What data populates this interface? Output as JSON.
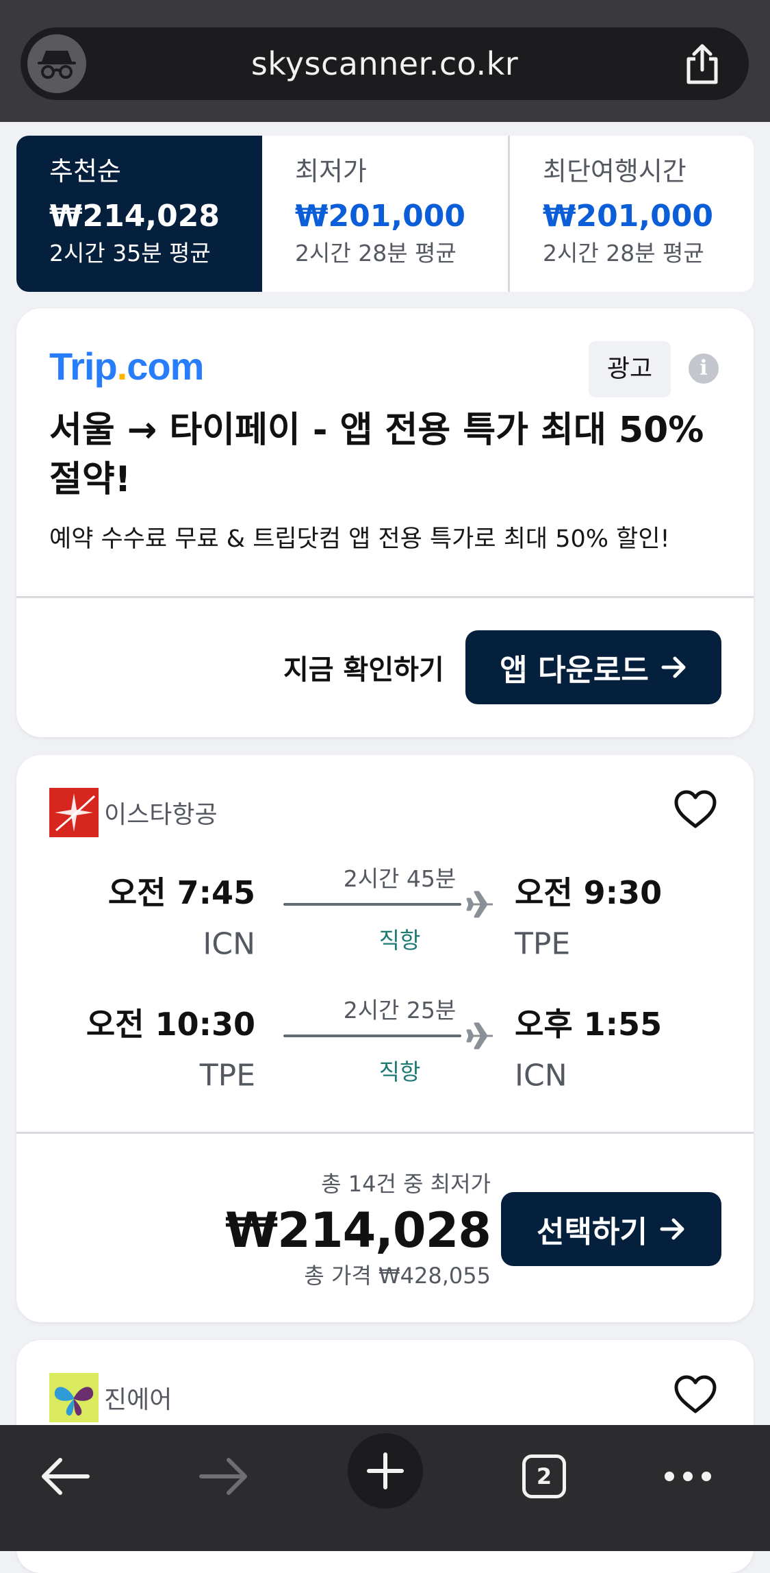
{
  "browser": {
    "url": "skyscanner.co.kr",
    "tab_count": "2"
  },
  "sort_tabs": [
    {
      "label": "추천순",
      "price": "₩214,028",
      "duration": "2시간 35분 평균",
      "selected": true
    },
    {
      "label": "최저가",
      "price": "₩201,000",
      "duration": "2시간 28분 평균",
      "selected": false
    },
    {
      "label": "최단여행시간",
      "price": "₩201,000",
      "duration": "2시간 28분 평균",
      "selected": false
    }
  ],
  "ad": {
    "logo_main": "Trip",
    "logo_dot": ".",
    "logo_tail": "com",
    "badge": "광고",
    "title": "서울 → 타이페이 - 앱 전용 특가 최대 50% 절약!",
    "description": "예약 수수료 무료 & 트립닷컴 앱 전용 특가로 최대 50% 할인!",
    "check_link": "지금 확인하기",
    "download_button": "앱 다운로드"
  },
  "flight_results": [
    {
      "airline": "이스타항공",
      "legs": [
        {
          "depart_time": "오전 7:45",
          "depart_code": "ICN",
          "duration": "2시간 45분",
          "stops": "직항",
          "arrive_time": "오전 9:30",
          "arrive_code": "TPE"
        },
        {
          "depart_time": "오전 10:30",
          "depart_code": "TPE",
          "duration": "2시간 25분",
          "stops": "직항",
          "arrive_time": "오후 1:55",
          "arrive_code": "ICN"
        }
      ],
      "price_note": "총 14건 중 최저가",
      "price": "₩214,028",
      "total_price": "총 가격 ₩428,055",
      "select_button": "선택하기"
    },
    {
      "airline": "진에어"
    }
  ],
  "colors": {
    "brand_dark": "#05203c",
    "price_blue": "#0b5ed7",
    "direct_teal": "#1e7a74",
    "trip_blue": "#287dfa"
  }
}
